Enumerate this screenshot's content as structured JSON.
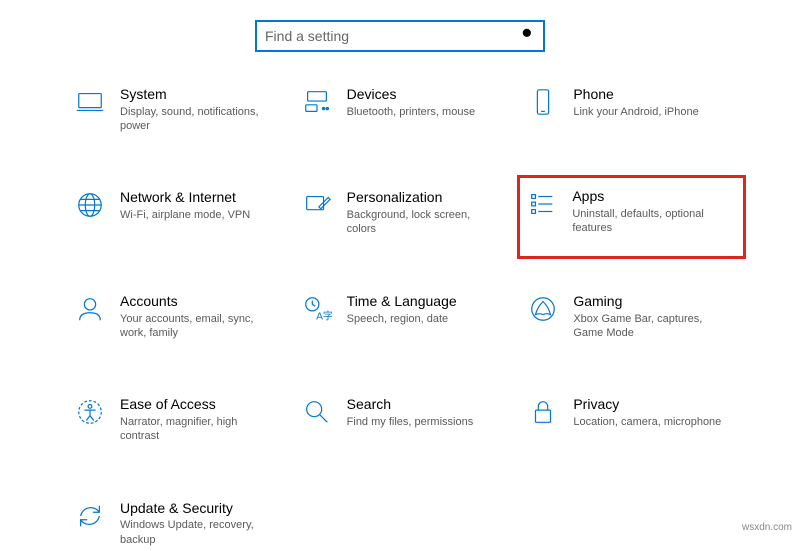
{
  "search": {
    "placeholder": "Find a setting"
  },
  "tiles": [
    {
      "id": "system",
      "title": "System",
      "desc": "Display, sound, notifications, power"
    },
    {
      "id": "devices",
      "title": "Devices",
      "desc": "Bluetooth, printers, mouse"
    },
    {
      "id": "phone",
      "title": "Phone",
      "desc": "Link your Android, iPhone"
    },
    {
      "id": "network",
      "title": "Network & Internet",
      "desc": "Wi-Fi, airplane mode, VPN"
    },
    {
      "id": "personalization",
      "title": "Personalization",
      "desc": "Background, lock screen, colors"
    },
    {
      "id": "apps",
      "title": "Apps",
      "desc": "Uninstall, defaults, optional features",
      "highlight": true
    },
    {
      "id": "accounts",
      "title": "Accounts",
      "desc": "Your accounts, email, sync, work, family"
    },
    {
      "id": "time",
      "title": "Time & Language",
      "desc": "Speech, region, date"
    },
    {
      "id": "gaming",
      "title": "Gaming",
      "desc": "Xbox Game Bar, captures, Game Mode"
    },
    {
      "id": "ease",
      "title": "Ease of Access",
      "desc": "Narrator, magnifier, high contrast"
    },
    {
      "id": "search",
      "title": "Search",
      "desc": "Find my files, permissions"
    },
    {
      "id": "privacy",
      "title": "Privacy",
      "desc": "Location, camera, microphone"
    },
    {
      "id": "update",
      "title": "Update & Security",
      "desc": "Windows Update, recovery, backup"
    }
  ],
  "attribution": "wsxdn.com"
}
